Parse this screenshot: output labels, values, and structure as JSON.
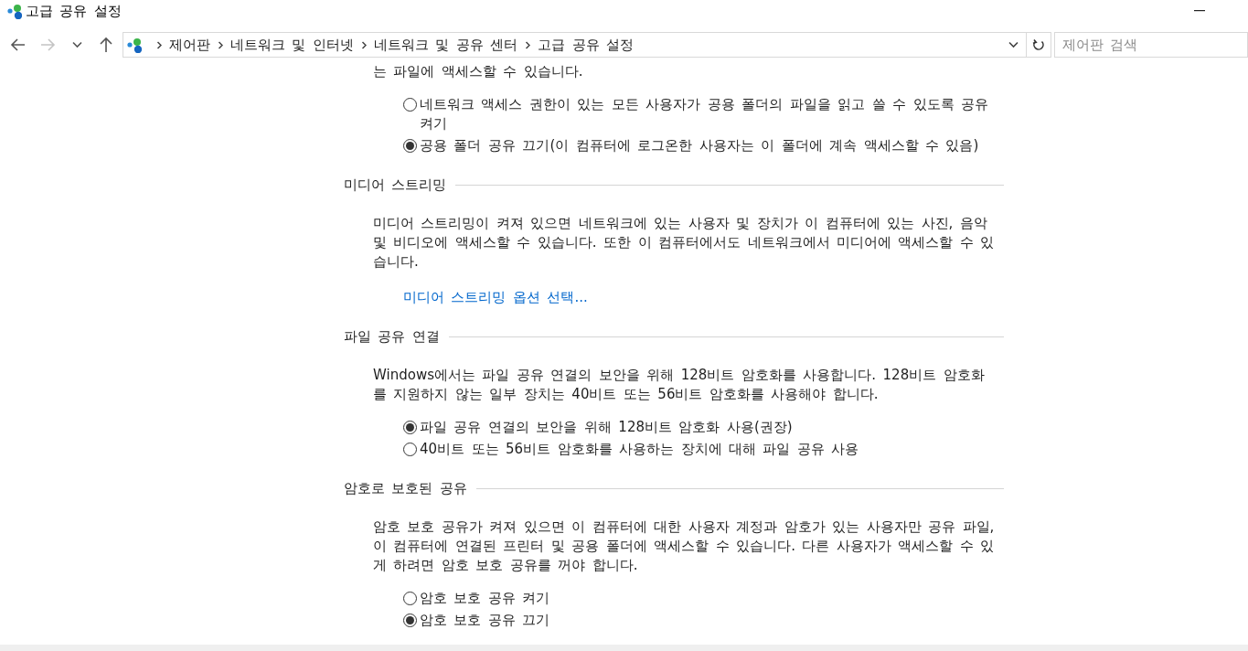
{
  "window": {
    "title": "고급 공유 설정"
  },
  "nav_buttons": [
    {
      "kind": "back",
      "disabled": false
    },
    {
      "kind": "forward",
      "disabled": true
    },
    {
      "kind": "recent",
      "disabled": false
    },
    {
      "kind": "up",
      "disabled": false
    }
  ],
  "address_bar": {
    "breadcrumbs": [
      "제어판",
      "네트워크 및 인터넷",
      "네트워크 및 공유 센터",
      "고급 공유 설정"
    ]
  },
  "search": {
    "placeholder": "제어판 검색"
  },
  "sections": [
    {
      "description": "는 파일에 액세스할 수 있습니다.",
      "options": [
        {
          "label": "네트워크 액세스 권한이 있는 모든 사용자가 공용 폴더의 파일을 읽고 쓸 수 있도록 공유 켜기",
          "selected": false
        },
        {
          "label": "공용 폴더 공유 끄기(이 컴퓨터에 로그온한 사용자는 이 폴더에 계속 액세스할 수 있음)",
          "selected": true
        }
      ]
    },
    {
      "heading": "미디어 스트리밍",
      "description": "미디어 스트리밍이 켜져 있으면 네트워크에 있는 사용자 및 장치가 이 컴퓨터에 있는 사진, 음악 및 비디오에 액세스할 수 있습니다. 또한 이 컴퓨터에서도 네트워크에서 미디어에 액세스할 수 있습니다.",
      "link": "미디어 스트리밍 옵션 선택..."
    },
    {
      "heading": "파일 공유 연결",
      "description": "Windows에서는 파일 공유 연결의 보안을 위해 128비트 암호화를 사용합니다. 128비트 암호화를 지원하지 않는 일부 장치는 40비트 또는 56비트 암호화를 사용해야 합니다.",
      "options": [
        {
          "label": "파일 공유 연결의 보안을 위해 128비트 암호화 사용(권장)",
          "selected": true
        },
        {
          "label": "40비트 또는 56비트 암호화를 사용하는 장치에 대해 파일 공유 사용",
          "selected": false
        }
      ]
    },
    {
      "heading": "암호로 보호된 공유",
      "description": "암호 보호 공유가 켜져 있으면 이 컴퓨터에 대한 사용자 계정과 암호가 있는 사용자만 공유 파일, 이 컴퓨터에 연결된 프린터 및 공용 폴더에 액세스할 수 있습니다. 다른 사용자가 액세스할 수 있게 하려면 암호 보호 공유를 꺼야 합니다.",
      "options": [
        {
          "label": "암호 보호 공유 켜기",
          "selected": false
        },
        {
          "label": "암호 보호 공유 끄기",
          "selected": true
        }
      ]
    }
  ]
}
